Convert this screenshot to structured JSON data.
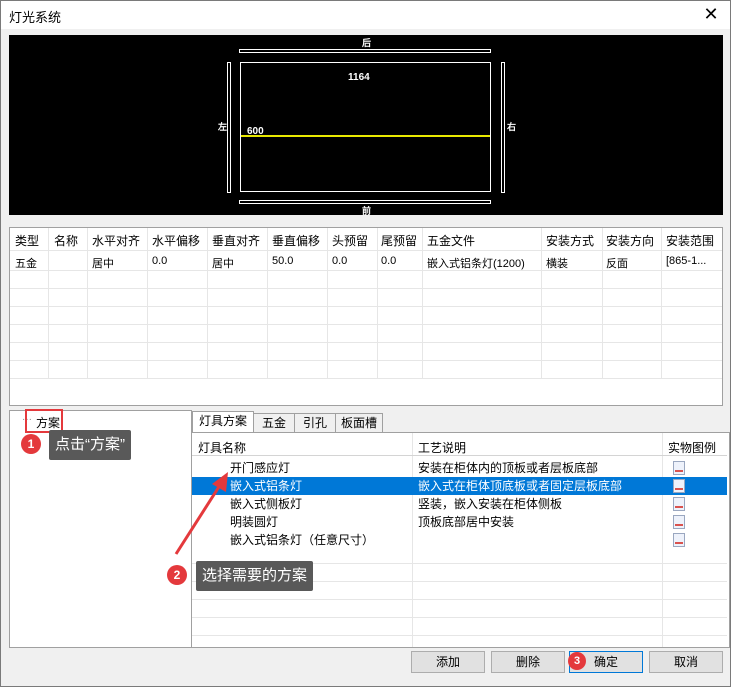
{
  "window": {
    "title": "灯光系统",
    "close_glyph": "✕"
  },
  "preview": {
    "label_top": "后",
    "label_bottom": "前",
    "label_left": "左",
    "label_right": "右",
    "width_value": "1164",
    "depth_value": "600"
  },
  "grid": {
    "headers": [
      "类型",
      "名称",
      "水平对齐",
      "水平偏移",
      "垂直对齐",
      "垂直偏移",
      "头预留",
      "尾预留",
      "五金文件",
      "安装方式",
      "安装方向",
      "安装范围"
    ],
    "row": [
      "五金",
      "",
      "居中",
      "0.0",
      "居中",
      "50.0",
      "0.0",
      "0.0",
      "嵌入式铝条灯(1200)",
      "横装",
      "反面",
      "[865-1..."
    ]
  },
  "tree": {
    "root_label": "方案",
    "prefix": "···"
  },
  "tabs": [
    "灯具方案",
    "五金",
    "引孔",
    "板面槽"
  ],
  "lamp_table": {
    "headers": {
      "name": "灯具名称",
      "desc": "工艺说明",
      "image": "实物图例"
    },
    "rows": [
      {
        "name": "开门感应灯",
        "desc": "安装在柜体内的顶板或者层板底部"
      },
      {
        "name": "嵌入式铝条灯",
        "desc": "嵌入式在柜体顶底板或者固定层板底部"
      },
      {
        "name": "嵌入式侧板灯",
        "desc": "竖装，嵌入安装在柜体侧板"
      },
      {
        "name": "明装圆灯",
        "desc": "顶板底部居中安装"
      },
      {
        "name": "嵌入式铝条灯（任意尺寸）",
        "desc": ""
      }
    ]
  },
  "buttons": {
    "add": "添加",
    "delete": "删除",
    "ok": "确定",
    "cancel": "取消"
  },
  "annotations": {
    "step1_num": "1",
    "step1_text": "点击“方案”",
    "step2_num": "2",
    "step2_text": "选择需要的方案",
    "step3_num": "3",
    "color": "#e4393c"
  }
}
